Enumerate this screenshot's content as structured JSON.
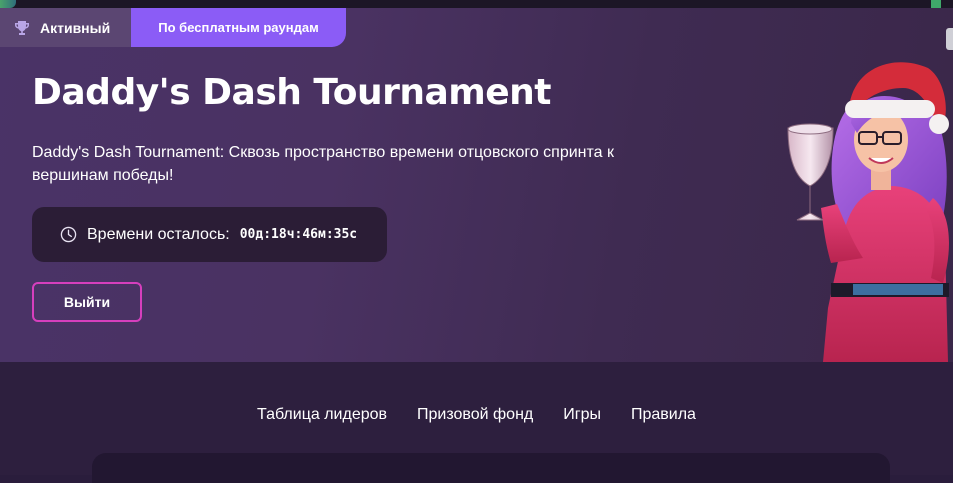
{
  "tabs": {
    "active_label": "Активный",
    "free_rounds_label": "По бесплатным раундам"
  },
  "tournament": {
    "title": "Daddy's Dash Tournament",
    "description": "Daddy's Dash Tournament: Сквозь пространство времени отцовского спринта к вершинам победы!",
    "timer_label": "Времени осталось:",
    "timer_value": "00д:18ч:46м:35с",
    "exit_label": "Выйти"
  },
  "nav": {
    "items": [
      {
        "label": "Таблица лидеров"
      },
      {
        "label": "Призовой фонд"
      },
      {
        "label": "Игры"
      },
      {
        "label": "Правила"
      }
    ]
  },
  "colors": {
    "accent": "#8b5cf6",
    "button_border": "#d63fbd",
    "hero_bg": "#4a3367",
    "nav_bg": "#2d1f3e"
  },
  "icons": [
    "trophy-icon",
    "clock-icon"
  ]
}
